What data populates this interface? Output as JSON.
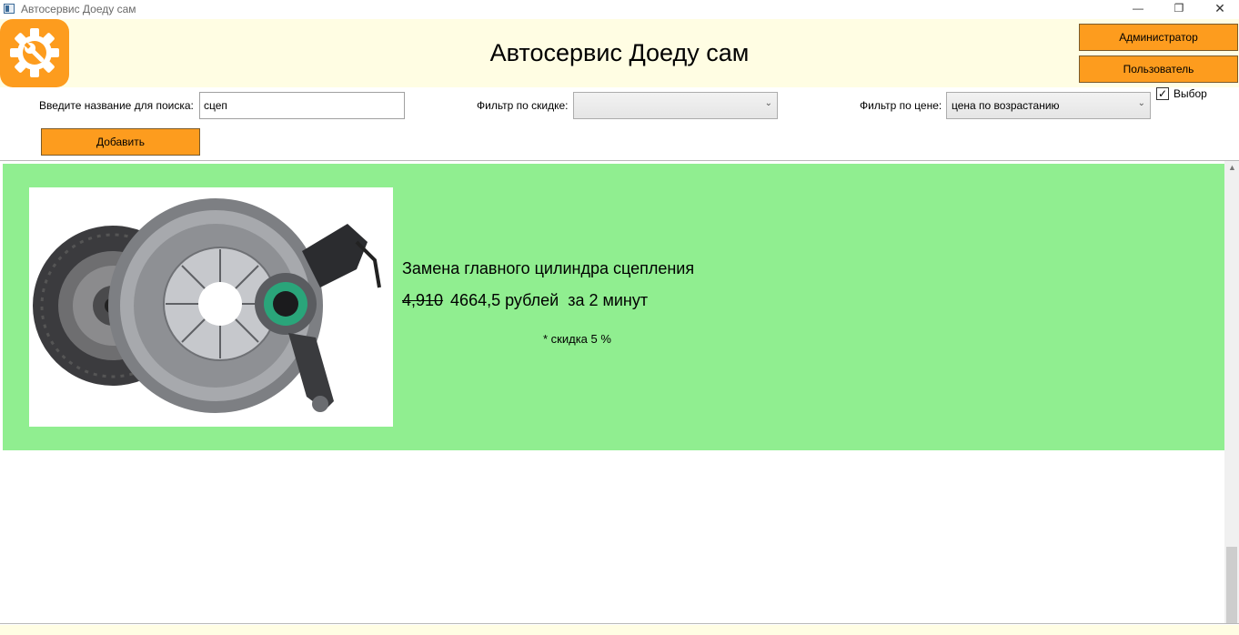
{
  "window": {
    "title": "Автосервис Доеду сам",
    "minimize": "—",
    "maximize": "❐",
    "close": "✕"
  },
  "header": {
    "title": "Автосервис Доеду сам",
    "logo_icon": "gear-wrench-icon",
    "admin_label": "Администратор",
    "user_label": "Пользователь"
  },
  "filters": {
    "search_label": "Введите название для поиска:",
    "search_value": "сцеп",
    "discount_label": "Фильтр по скидке:",
    "discount_value": "",
    "price_label": "Фильтр по цене:",
    "price_value": "цена по возрастанию",
    "checkbox_label": "Выбор",
    "checkbox_checked": true,
    "add_label": "Добавить"
  },
  "services": [
    {
      "name": "Замена главного цилиндра сцепления",
      "old_price": "4,910",
      "new_price": "4664,5 рублей",
      "duration": "за 2 минут",
      "discount_text": "* скидка 5 %",
      "image_icon": "clutch-kit-image",
      "highlight_color": "#90ee90"
    }
  ],
  "colors": {
    "accent": "#fd9c1e",
    "header_bg": "#fffde3"
  }
}
